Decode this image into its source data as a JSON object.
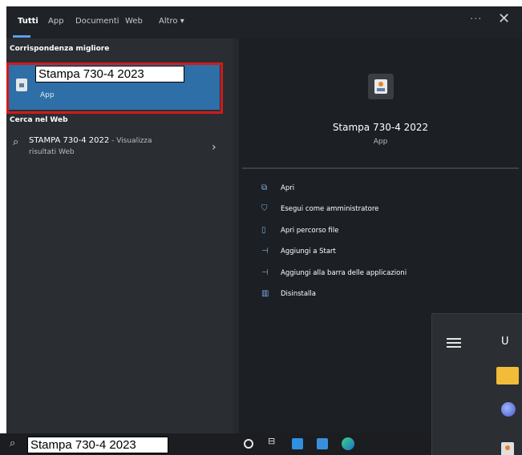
{
  "tabs": [
    {
      "label": "Tutti"
    },
    {
      "label": "App"
    },
    {
      "label": "Documenti"
    },
    {
      "label": "Web"
    },
    {
      "label": "Altro ▾"
    }
  ],
  "header": {
    "more": "···",
    "close": "✕"
  },
  "best_match": {
    "header": "Corrispondenza migliore",
    "label": "Stampa 730-4 2023",
    "type": "App"
  },
  "web": {
    "header": "Cerca nel Web",
    "title": "STAMPA 730-4 2022",
    "title_suffix": " - Visualizza",
    "subtitle": "risultati Web",
    "chevron": "›"
  },
  "detail": {
    "title": "Stampa 730-4 2022",
    "type": "App"
  },
  "actions": [
    {
      "label": "Apri",
      "icon": "open-icon"
    },
    {
      "label": "Esegui come amministratore",
      "icon": "admin-icon"
    },
    {
      "label": "Apri percorso file",
      "icon": "file-location-icon"
    },
    {
      "label": "Aggiungi a Start",
      "icon": "pin-icon"
    },
    {
      "label": "Aggiungi alla barra delle applicazioni",
      "icon": "pin-icon"
    },
    {
      "label": "Disinstalla",
      "icon": "trash-icon"
    }
  ],
  "taskbar": {
    "search_value": "Stampa 730-4 2023"
  },
  "start_menu": {
    "user_initial": "U"
  }
}
